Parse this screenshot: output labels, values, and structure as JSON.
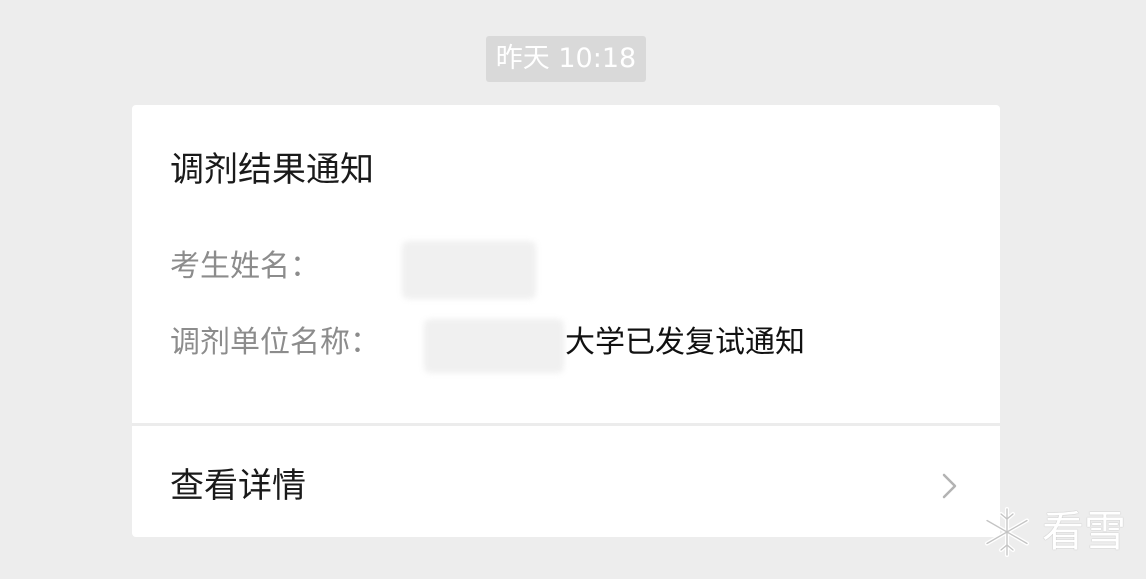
{
  "timestamp": "昨天 10:18",
  "card": {
    "title": "调剂结果通知",
    "fields": [
      {
        "label": "考生姓名：",
        "value": ""
      },
      {
        "label": "调剂单位名称：",
        "value": "大学已发复试通知"
      }
    ],
    "link_label": "查看详情",
    "link_icon": "chevron-right-icon"
  },
  "watermark": {
    "icon": "snowflake-icon",
    "text": "看雪"
  },
  "colors": {
    "background": "#ededed",
    "card": "#ffffff",
    "label": "#8c8c8c",
    "timestamp_bg": "#d9d9d9"
  }
}
